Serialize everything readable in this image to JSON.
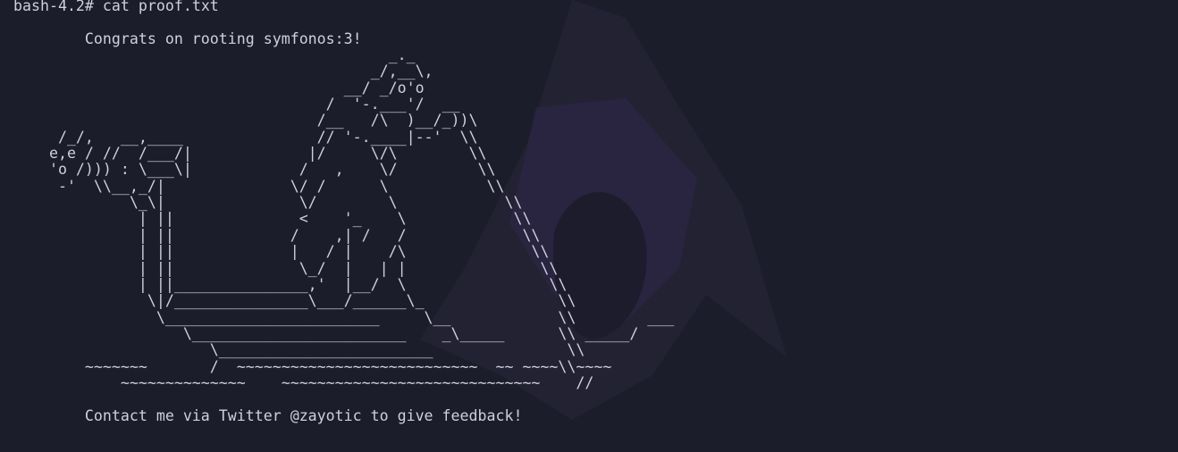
{
  "theme": {
    "background": "#1b1d2b",
    "foreground": "#d0d0dc",
    "logo_tint": "#3a2f4a"
  },
  "terminal": {
    "prompt": "bash-4.2#",
    "command": "cat proof.txt",
    "output_lines": [
      "",
      "        Congrats on rooting symfonos:3!",
      "                                          _._",
      "                                        _/,__\\,",
      "                                     __/ _/o'o",
      "                                   /  '-.___'/  __",
      "                                  /__   /\\  )__/_))\\",
      "     /_/,   __,____               // '-.____|--'  \\\\",
      "    e,e / //  /___/|             |/     \\/\\        \\\\",
      "    'o /))) : \\___\\|            /   ,    \\/         \\\\",
      "     -'  \\\\__,_/|              \\/ /      \\           \\\\",
      "             \\_\\|               \\/        \\            \\\\",
      "              | ||              <    '_    \\            \\\\",
      "              | ||             /    ,| /   /             \\\\",
      "              | ||             |   / |    /\\              \\\\",
      "              | ||              \\_/  |   | |               \\\\",
      "              | ||_______________,'  |__/  \\                \\\\",
      "               \\|/_______________\\___/______\\_               \\\\",
      "                \\________________________     \\__            \\\\        ___",
      "                   \\________________________    _\\_____      \\\\ _____/",
      "                      \\________________________               \\\\",
      "        ~~~~~~~       /  ~~~~~~~~~~~~~~~~~~~~~~~~~~~  ~~ ~~~~\\\\~~~~",
      "            ~~~~~~~~~~~~~~    ~~~~~~~~~~~~~~~~~~~~~~~~~~~~~    //",
      "",
      "        Contact me via Twitter @zayotic to give feedback!"
    ]
  }
}
